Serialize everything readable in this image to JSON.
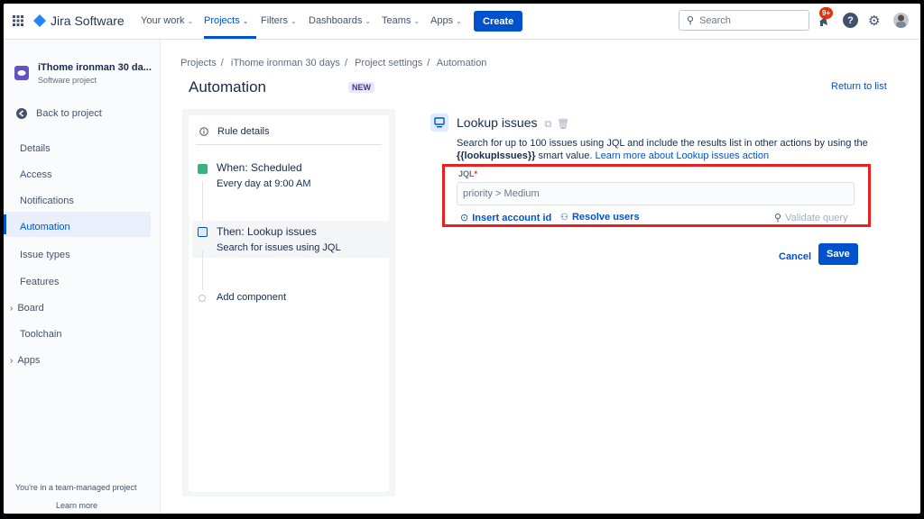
{
  "topnav": {
    "product_name": "Jira Software",
    "items": [
      {
        "label": "Your work"
      },
      {
        "label": "Projects"
      },
      {
        "label": "Filters"
      },
      {
        "label": "Dashboards"
      },
      {
        "label": "Teams"
      },
      {
        "label": "Apps"
      }
    ],
    "create_label": "Create",
    "search_placeholder": "Search",
    "notifications_badge": "9+",
    "help_glyph": "?"
  },
  "sidebar": {
    "project_name": "iThome ironman 30 da...",
    "project_type": "Software project",
    "back_label": "Back to project",
    "items": [
      {
        "label": "Details"
      },
      {
        "label": "Access"
      },
      {
        "label": "Notifications"
      },
      {
        "label": "Automation"
      },
      {
        "label": "Issue types"
      },
      {
        "label": "Features"
      },
      {
        "label": "Board"
      },
      {
        "label": "Toolchain"
      },
      {
        "label": "Apps"
      }
    ],
    "footer_text": "You're in a team-managed project",
    "footer_link": "Learn more"
  },
  "breadcrumb": [
    "Projects",
    "iThome ironman 30 days",
    "Project settings",
    "Automation"
  ],
  "page": {
    "title": "Automation",
    "badge": "NEW",
    "return_link": "Return to list"
  },
  "rule": {
    "details_label": "Rule details",
    "trigger_title": "When: Scheduled",
    "trigger_desc": "Every day at 9:00 AM",
    "action_title": "Then: Lookup issues",
    "action_desc": "Search for issues using JQL",
    "add_component": "Add component"
  },
  "detail": {
    "title": "Lookup issues",
    "desc_text": "Search for up to 100 issues using JQL and include the results list in other actions by using the",
    "smart_value": "{{lookupIssues}}",
    "desc_suffix": "smart value.",
    "learn_more": "Learn more about Lookup issues action",
    "jql_label": "JQL",
    "jql_required": "*",
    "jql_value": "priority > Medium",
    "insert_account": "Insert account id",
    "resolve_users": "Resolve users",
    "validate_query": "Validate query",
    "cancel": "Cancel",
    "save": "Save"
  },
  "colors": {
    "primary": "#0052cc",
    "highlight": "#e52222",
    "badge_red": "#de350b"
  }
}
